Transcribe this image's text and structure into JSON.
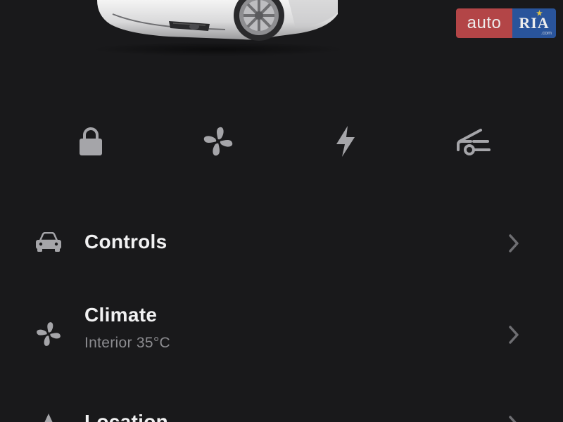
{
  "quick_actions": [
    {
      "icon": "lock-icon",
      "label": ""
    },
    {
      "icon": "fan-icon",
      "label": ""
    },
    {
      "icon": "lightning-bolt-icon",
      "label": ""
    },
    {
      "icon": "frunk-icon",
      "label": ""
    }
  ],
  "menu": {
    "controls": {
      "title": "Controls",
      "icon": "car-icon"
    },
    "climate": {
      "title": "Climate",
      "subtitle": "Interior 35°C",
      "icon": "fan-icon"
    },
    "location": {
      "title": "Location",
      "icon": "navigation-arrow-icon"
    }
  },
  "watermark": {
    "left_text": "auto",
    "right_text": "RIA",
    "right_suffix": ".com"
  },
  "colors": {
    "background": "#19191b",
    "icon": "#a5a5a9",
    "text_primary": "#f1f1f2",
    "text_secondary": "#8c8c90",
    "watermark_red": "#c1494b",
    "watermark_blue": "#2b5aa6"
  }
}
